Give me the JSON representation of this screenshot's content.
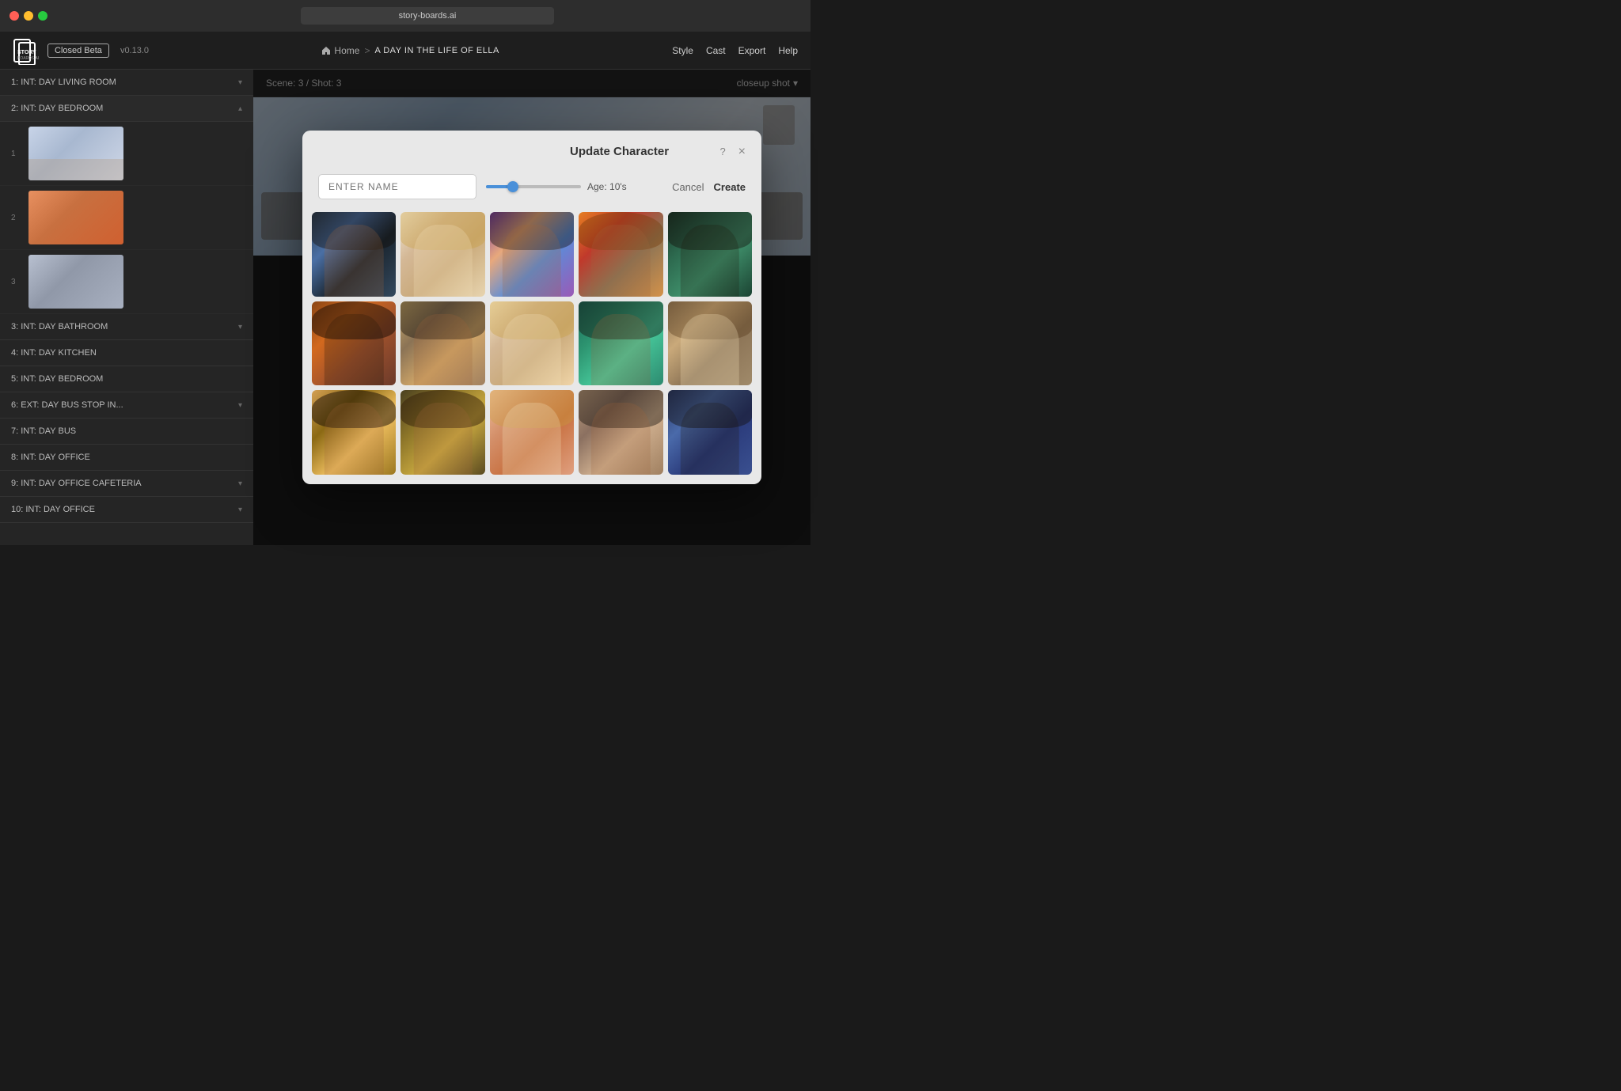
{
  "browser": {
    "url": "story-boards.ai"
  },
  "header": {
    "logo_alt": "StoryBoards.ai",
    "beta_label": "Closed Beta",
    "version": "v0.13.0",
    "breadcrumb": {
      "home": "Home",
      "separator": ">",
      "current": "A DAY IN THE LIFE OF ELLA"
    },
    "nav": {
      "style": "Style",
      "cast": "Cast",
      "export": "Export",
      "help": "Help"
    }
  },
  "sidebar": {
    "scenes": [
      {
        "id": 1,
        "label": "1: INT: DAY LIVING ROOM",
        "expanded": false
      },
      {
        "id": 2,
        "label": "2: INT: DAY BEDROOM",
        "expanded": true
      },
      {
        "id": 3,
        "label": "3: INT: DAY BATHROOM",
        "expanded": false
      },
      {
        "id": 4,
        "label": "4: INT: DAY KITCHEN",
        "expanded": false
      },
      {
        "id": 5,
        "label": "5: INT: DAY BEDROOM",
        "expanded": false
      },
      {
        "id": 6,
        "label": "6: EXT: DAY BUS STOP IN...",
        "expanded": false
      },
      {
        "id": 7,
        "label": "7: INT: DAY BUS",
        "expanded": false
      },
      {
        "id": 8,
        "label": "8: INT: DAY OFFICE",
        "expanded": false
      },
      {
        "id": 9,
        "label": "9: INT: DAY OFFICE CAFETERIA",
        "expanded": false
      },
      {
        "id": 10,
        "label": "10: INT: DAY OFFICE",
        "expanded": false
      }
    ],
    "thumbnails": [
      {
        "num": "1",
        "type": "tb1"
      },
      {
        "num": "2",
        "type": "tb2"
      },
      {
        "num": "3",
        "type": "tb3"
      }
    ]
  },
  "main": {
    "scene_info": "Scene: 3 / Shot: 3",
    "shot_type": "closeup shot"
  },
  "modal": {
    "title": "Update Character",
    "help_icon": "?",
    "close_icon": "×",
    "name_placeholder": "ENTER NAME",
    "age_label": "Age: 10's",
    "cancel_label": "Cancel",
    "create_label": "Create",
    "slider_percent": 30,
    "characters": [
      {
        "id": 1,
        "style": "p1"
      },
      {
        "id": 2,
        "style": "p2"
      },
      {
        "id": 3,
        "style": "p3"
      },
      {
        "id": 4,
        "style": "p4"
      },
      {
        "id": 5,
        "style": "p5"
      },
      {
        "id": 6,
        "style": "p6"
      },
      {
        "id": 7,
        "style": "p7"
      },
      {
        "id": 8,
        "style": "p8"
      },
      {
        "id": 9,
        "style": "p9"
      },
      {
        "id": 10,
        "style": "p10"
      },
      {
        "id": 11,
        "style": "p11"
      },
      {
        "id": 12,
        "style": "p12"
      },
      {
        "id": 13,
        "style": "p13"
      },
      {
        "id": 14,
        "style": "p14"
      },
      {
        "id": 15,
        "style": "p15"
      }
    ]
  }
}
